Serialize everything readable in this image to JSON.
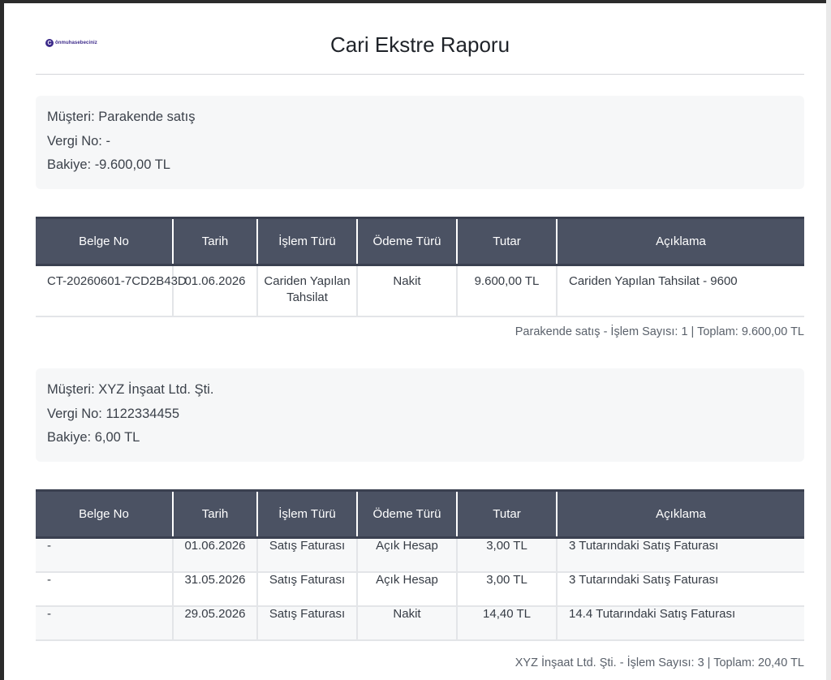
{
  "report": {
    "logo_text": "ônmuhasebeciniz",
    "title": "Cari Ekstre Raporu",
    "columns": [
      "Belge No",
      "Tarih",
      "İşlem Türü",
      "Ödeme Türü",
      "Tutar",
      "Açıklama"
    ]
  },
  "customers": [
    {
      "name_line": "Müşteri: Parakende satış",
      "tax_line": "Vergi No: -",
      "balance_line": "Bakiye: -9.600,00 TL",
      "rows": [
        {
          "belge_no": "CT-20260601-7CD2B43D",
          "tarih": "01.06.2026",
          "islem_turu": "Cariden Yapılan Tahsilat",
          "odeme_turu": "Nakit",
          "tutar": "9.600,00 TL",
          "aciklama": "Cariden Yapılan Tahsilat - 9600"
        }
      ],
      "summary": "Parakende satış - İşlem Sayısı: 1 | Toplam: 9.600,00 TL"
    },
    {
      "name_line": "Müşteri: XYZ İnşaat Ltd. Şti.",
      "tax_line": "Vergi No: 1122334455",
      "balance_line": "Bakiye: 6,00 TL",
      "rows": [
        {
          "belge_no": "-",
          "tarih": "01.06.2026",
          "islem_turu": "Satış Faturası",
          "odeme_turu": "Açık Hesap",
          "tutar": "3,00 TL",
          "aciklama": "3 Tutarındaki Satış Faturası"
        },
        {
          "belge_no": "-",
          "tarih": "31.05.2026",
          "islem_turu": "Satış Faturası",
          "odeme_turu": "Açık Hesap",
          "tutar": "3,00 TL",
          "aciklama": "3 Tutarındaki Satış Faturası"
        },
        {
          "belge_no": "-",
          "tarih": "29.05.2026",
          "islem_turu": "Satış Faturası",
          "odeme_turu": "Nakit",
          "tutar": "14,40 TL",
          "aciklama": "14.4 Tutarındaki Satış Faturası"
        }
      ],
      "summary": "XYZ İnşaat Ltd. Şti. - İşlem Sayısı: 3 | Toplam: 20,40 TL"
    }
  ]
}
